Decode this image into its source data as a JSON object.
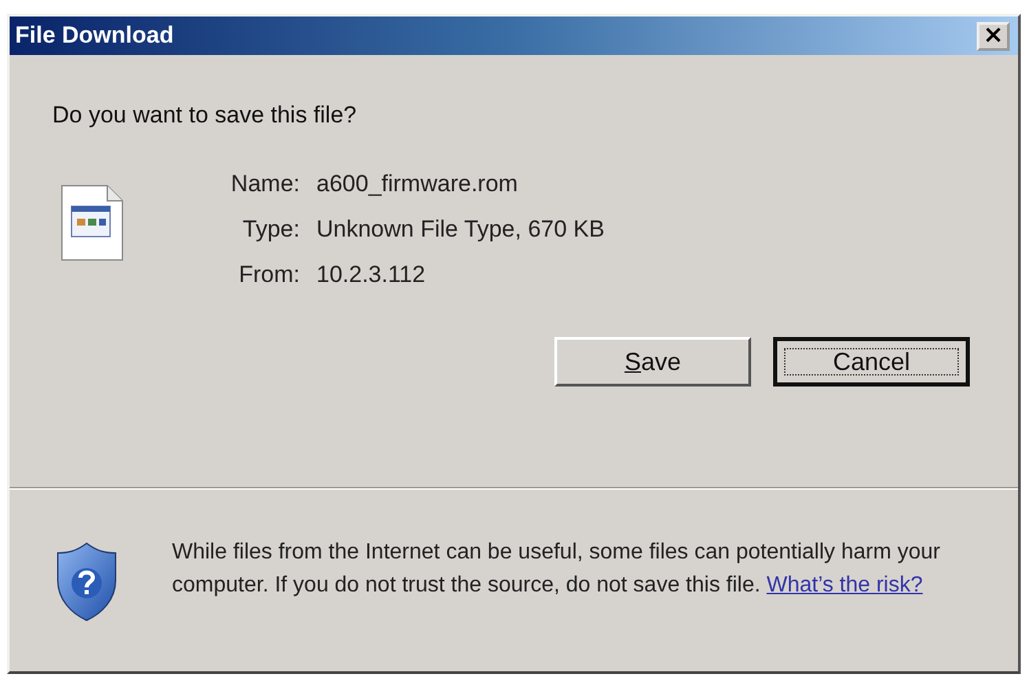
{
  "window": {
    "title": "File Download",
    "close": "×"
  },
  "question": "Do you want to save this file?",
  "details": [
    {
      "label": "Name:",
      "value": "a600_firmware.rom"
    },
    {
      "label": "Type:",
      "value": "Unknown File Type, 670 KB"
    },
    {
      "label": "From:",
      "value": "10.2.3.112"
    }
  ],
  "buttons": [
    {
      "access_key": "S",
      "label_rest": "ave",
      "default": false
    },
    {
      "label": "Cancel",
      "default": true
    }
  ],
  "warning": {
    "text": "While files from the Internet can be useful, some files can potentially harm your computer. If you do not trust the source, do not save this file.",
    "link": "What’s the risk?"
  }
}
